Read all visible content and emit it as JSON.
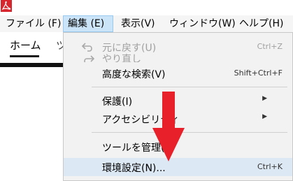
{
  "menubar": {
    "file": "ファイル (F)",
    "edit": "編集 (E)",
    "view": "表示(V)",
    "window": "ウィンドウ(W)",
    "help": "ヘルプ(H)"
  },
  "toolbar": {
    "home_tab": "ホーム",
    "tools_tab_partial": "ツ"
  },
  "edit_menu": {
    "items": [
      {
        "label": "元に戻す(U)",
        "shortcut": "Ctrl+Z",
        "enabled": false
      },
      {
        "label": "やり直し",
        "shortcut": "",
        "enabled": false
      },
      {
        "label": "高度な検索(V)",
        "shortcut": "Shift+Ctrl+F",
        "enabled": true
      },
      {
        "label": "保護(I)",
        "shortcut": "",
        "enabled": true,
        "submenu": true
      },
      {
        "label": "アクセシビリティ",
        "shortcut": "",
        "enabled": true,
        "submenu": true
      },
      {
        "label": "ツールを管理(",
        "shortcut": "",
        "enabled": true
      },
      {
        "label": "環境設定(N)...",
        "shortcut": "Ctrl+K",
        "enabled": true,
        "highlighted": true
      }
    ]
  },
  "icons": {
    "app": "acrobat-icon",
    "undo": "undo-icon",
    "redo": "redo-icon",
    "submenu_arrow": "chevron-right-icon",
    "annotation": "red-down-arrow"
  },
  "colors": {
    "accent_red": "#e8202a",
    "highlight": "#dde8f5",
    "menu_active": "#cce4f7"
  }
}
